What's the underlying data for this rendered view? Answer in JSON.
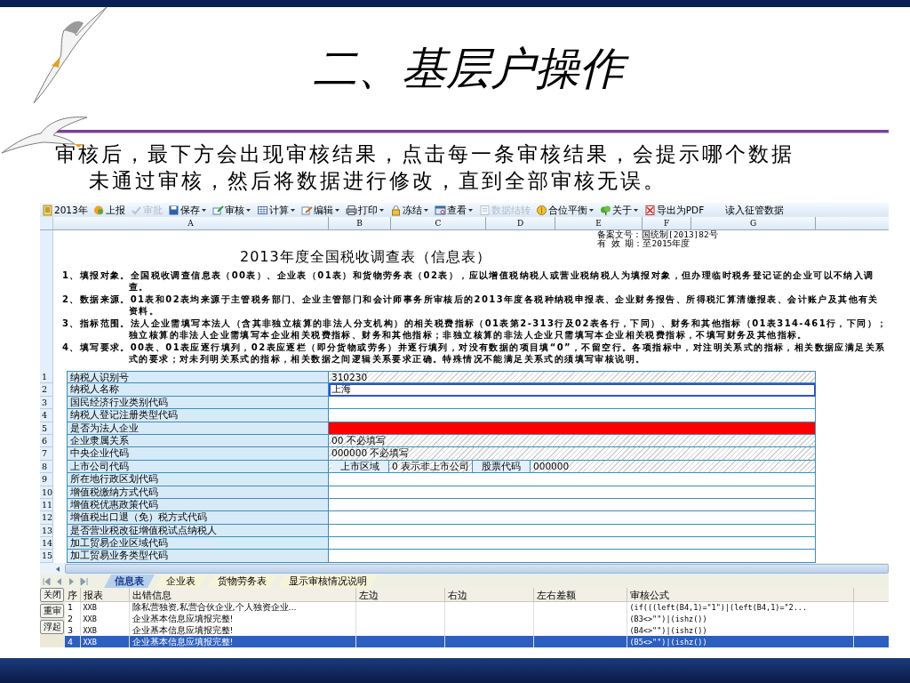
{
  "slide": {
    "title": "二、基层户操作",
    "body": "审核后，最下方会出现审核结果，点击每一条审核结果，会提示哪个数据未通过审核，然后将数据进行修改，直到全部审核无误。"
  },
  "toolbar": [
    {
      "label": "2013年",
      "dropdown": false,
      "disabled": false
    },
    {
      "label": "上报",
      "dropdown": false,
      "disabled": false
    },
    {
      "label": "审批",
      "dropdown": false,
      "disabled": true
    },
    {
      "label": "保存",
      "dropdown": true,
      "disabled": false
    },
    {
      "label": "审核",
      "dropdown": true,
      "disabled": false
    },
    {
      "label": "计算",
      "dropdown": true,
      "disabled": false
    },
    {
      "label": "编辑",
      "dropdown": true,
      "disabled": false
    },
    {
      "label": "打印",
      "dropdown": true,
      "disabled": false
    },
    {
      "label": "冻结",
      "dropdown": true,
      "disabled": false
    },
    {
      "label": "查看",
      "dropdown": true,
      "disabled": false
    },
    {
      "label": "数据结转",
      "dropdown": false,
      "disabled": true
    },
    {
      "label": "合位平衡",
      "dropdown": true,
      "disabled": false
    },
    {
      "label": "关于",
      "dropdown": true,
      "disabled": false
    },
    {
      "label": "导出为PDF",
      "dropdown": false,
      "disabled": false
    },
    {
      "label": "读入征管数据",
      "dropdown": false,
      "disabled": false
    }
  ],
  "column_headers": [
    "A",
    "B",
    "C",
    "D",
    "E",
    "F",
    "G"
  ],
  "form": {
    "filing_lines": [
      "备案文号：国统制[2013]82号",
      "有 效 期：至2015年度"
    ],
    "title": "2013年度全国税收调查表（信息表）",
    "instructions": [
      "1、填报对象。全国税收调查信息表（00表）、企业表（01表）和货物劳务表（02表），应以增值税纳税人或营业税纳税人为填报对象，但办理临时税务登记证的企业可以不纳入调查。",
      "2、数据来源。01表和02表均来源于主管税务部门、企业主管部门和会计师事务所审核后的2013年度各税种纳税申报表、企业财务报告、所得税汇算清缴报表、会计账户及其他有关资料。",
      "3、指标范围。法人企业需填写本法人（含其非独立核算的非法人分支机构）的相关税费指标（01表第2-313行及02表各行，下同）、财务和其他指标（01表314-461行，下同）；独立核算的非法人企业需填写本企业相关税费指标、财务和其他指标；非独立核算的非法人企业只需填写本企业相关税费指标，不填写财务及其他指标。",
      "4、填写要求。00表、01表应逐行填列，02表应逐栏（即分货物或劳务）并逐行填列，对没有数据的项目填“0”，不留空行。各项指标中，对注明关系式的指标，相关数据应满足关系式的要求；对未列明关系式的指标，相关数据之间逻辑关系要求正确。特殊情况不能满足关系式的须填写审核说明。"
    ]
  },
  "rows": [
    {
      "number": "1",
      "label": "纳税人识别号",
      "kind": "locked",
      "value": "310230",
      "selected": false
    },
    {
      "number": "2",
      "label": "纳税人名称",
      "kind": "input",
      "value": "上海",
      "selected": true
    },
    {
      "number": "3",
      "label": "国民经济行业类别代码",
      "kind": "blank",
      "selected": false
    },
    {
      "number": "4",
      "label": "纳税人登记注册类型代码",
      "kind": "blank",
      "selected": false
    },
    {
      "number": "5",
      "label": "是否为法人企业",
      "kind": "error",
      "selected": false
    },
    {
      "number": "6",
      "label": "企业隶属关系",
      "kind": "locked",
      "value": "00  不必填写",
      "selected": false
    },
    {
      "number": "7",
      "label": "中央企业代码",
      "kind": "locked",
      "value": "000000  不必填写",
      "selected": false
    },
    {
      "number": "8",
      "label": "上市公司代码",
      "kind": "split",
      "selected": false,
      "parts": [
        {
          "text": "上市区域",
          "kind": "caption"
        },
        {
          "text": "0  表示非上市公司",
          "kind": "locked"
        },
        {
          "text": "股票代码",
          "kind": "caption"
        },
        {
          "text": "000000",
          "kind": "locked"
        }
      ]
    },
    {
      "number": "9",
      "label": "所在地行政区划代码",
      "kind": "blank",
      "selected": false
    },
    {
      "number": "10",
      "label": "增值税缴纳方式代码",
      "kind": "blank",
      "selected": false
    },
    {
      "number": "11",
      "label": "增值税优惠政策代码",
      "kind": "blank",
      "selected": false
    },
    {
      "number": "12",
      "label": "增值税出口退（免）税方式代码",
      "kind": "blank",
      "selected": false
    },
    {
      "number": "13",
      "label": "是否营业税改征增值税试点纳税人",
      "kind": "blank",
      "selected": false
    },
    {
      "number": "14",
      "label": "加工贸易企业区域代码",
      "kind": "blank",
      "selected": false
    },
    {
      "number": "15",
      "label": "加工贸易业务类型代码",
      "kind": "blank",
      "selected": false
    }
  ],
  "sheet_tabs": [
    {
      "label": "信息表",
      "selected": true
    },
    {
      "label": "企业表",
      "selected": false
    },
    {
      "label": "货物劳务表",
      "selected": false
    },
    {
      "label": "显示审核情况说明",
      "selected": false
    }
  ],
  "side_buttons": [
    "关闭",
    "重审",
    "浮起"
  ],
  "results": {
    "columns": [
      "序",
      "报表",
      "出错信息",
      "左边",
      "右边",
      "左右差额",
      "审核公式"
    ],
    "rows": [
      {
        "index": "1",
        "sheet": "XXB",
        "message": "除私营独资,私营合伙企业,个人独资企业...",
        "formula": "(if(((left(B4,1)=\"1\")|(left(B4,1)=\"2...",
        "selected": false
      },
      {
        "index": "2",
        "sheet": "XXB",
        "message": "企业基本信息应填报完整!",
        "formula": "(B3<>\"\")|(ishz())",
        "selected": false
      },
      {
        "index": "3",
        "sheet": "XXB",
        "message": "企业基本信息应填报完整!",
        "formula": "(B4<>\"\")|(ishz())",
        "selected": false
      },
      {
        "index": "4",
        "sheet": "XXB",
        "message": "企业基本信息应填报完整!",
        "formula": "(B5<>\"\")|(ishz())",
        "selected": true
      }
    ]
  }
}
